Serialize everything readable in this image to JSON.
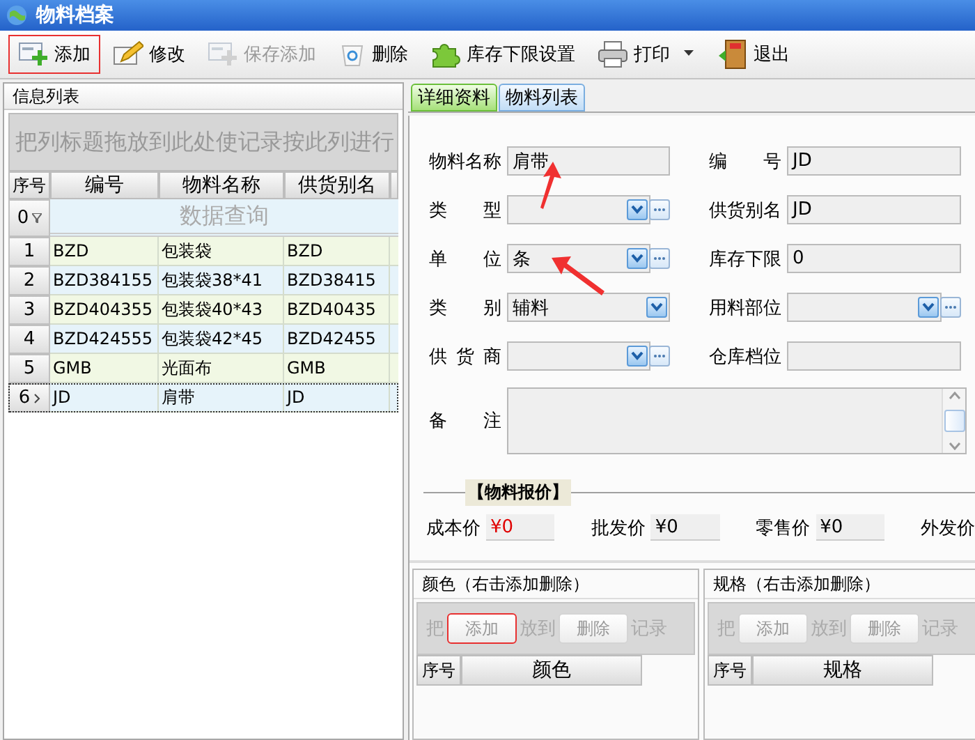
{
  "window": {
    "title": "物料档案"
  },
  "toolbar": [
    {
      "label": "添加",
      "disabled": false,
      "highlighted": true
    },
    {
      "label": "修改",
      "disabled": false,
      "highlighted": false
    },
    {
      "label": "保存添加",
      "disabled": true,
      "highlighted": false
    },
    {
      "label": "删除",
      "disabled": false,
      "highlighted": false
    },
    {
      "label": "库存下限设置",
      "disabled": false,
      "highlighted": false
    },
    {
      "label": "打印",
      "disabled": false,
      "highlighted": false,
      "dropdown": true
    },
    {
      "label": "退出",
      "disabled": false,
      "highlighted": false
    }
  ],
  "info_list": {
    "title": "信息列表",
    "group_hint": "把列标题拖放到此处使记录按此列进行",
    "columns": [
      "序号",
      "编号",
      "物料名称",
      "供货别名"
    ],
    "filter": {
      "number": "0",
      "placeholder": "数据查询"
    },
    "rows": [
      {
        "cells": [
          "1",
          "BZD",
          "包装袋",
          "BZD"
        ],
        "selected": false
      },
      {
        "cells": [
          "2",
          "BZD384155",
          "包装袋38*41",
          "BZD38415"
        ],
        "selected": false
      },
      {
        "cells": [
          "3",
          "BZD404355",
          "包装袋40*43",
          "BZD40435"
        ],
        "selected": false
      },
      {
        "cells": [
          "4",
          "BZD424555",
          "包装袋42*45",
          "BZD42455"
        ],
        "selected": false
      },
      {
        "cells": [
          "5",
          "GMB",
          "光面布",
          "GMB"
        ],
        "selected": false
      },
      {
        "cells": [
          "6",
          "JD",
          "肩带",
          "JD"
        ],
        "selected": true
      }
    ]
  },
  "tabs": [
    {
      "label": "详细资料",
      "selected": true
    },
    {
      "label": "物料列表",
      "selected": false
    }
  ],
  "form_rows": [
    {
      "left": {
        "label": "物料名称",
        "kind": "text",
        "value": "肩带"
      },
      "right": {
        "label": "编 号",
        "kind": "text",
        "value": "JD"
      }
    },
    {
      "left": {
        "label": "类 型",
        "kind": "select",
        "ellipsis": true
      },
      "right": {
        "label": "供货别名",
        "kind": "text",
        "value": "JD"
      }
    },
    {
      "left": {
        "label": "单 位",
        "kind": "select",
        "ellipsis": true,
        "value": "条"
      },
      "right": {
        "label": "库存下限",
        "kind": "text",
        "value": "0"
      }
    },
    {
      "left": {
        "label": "类 别",
        "kind": "select",
        "ellipsis": false,
        "value": "辅料"
      },
      "right": {
        "label": "用料部位",
        "kind": "select",
        "ellipsis": true
      }
    },
    {
      "left": {
        "label": "供 货 商",
        "kind": "select",
        "ellipsis": true
      },
      "right": {
        "label": "仓库档位",
        "kind": "text"
      }
    }
  ],
  "remarks": {
    "label": "备 注"
  },
  "pricing": {
    "title": "【物料报价】",
    "items": [
      {
        "label": "成本价",
        "value": "¥0",
        "emphasis": true
      },
      {
        "label": "批发价",
        "value": "¥0",
        "emphasis": false
      },
      {
        "label": "零售价",
        "value": "¥0",
        "emphasis": false
      },
      {
        "label": "外发价"
      }
    ]
  },
  "sub_panels": [
    {
      "title": "颜色（右击添加删除）",
      "hint_fragments": [
        "把",
        "放到",
        "记录"
      ],
      "buttons": [
        {
          "label": "添加",
          "highlighted": true
        },
        {
          "label": "删除",
          "highlighted": false
        }
      ],
      "columns": [
        "序号",
        "颜色"
      ]
    },
    {
      "title": "规格（右击添加删除）",
      "hint_fragments": [
        "把",
        "放到",
        "记录"
      ],
      "buttons": [
        {
          "label": "添加",
          "highlighted": false
        },
        {
          "label": "删除",
          "highlighted": false
        }
      ],
      "columns": [
        "序号",
        "规格"
      ]
    }
  ]
}
